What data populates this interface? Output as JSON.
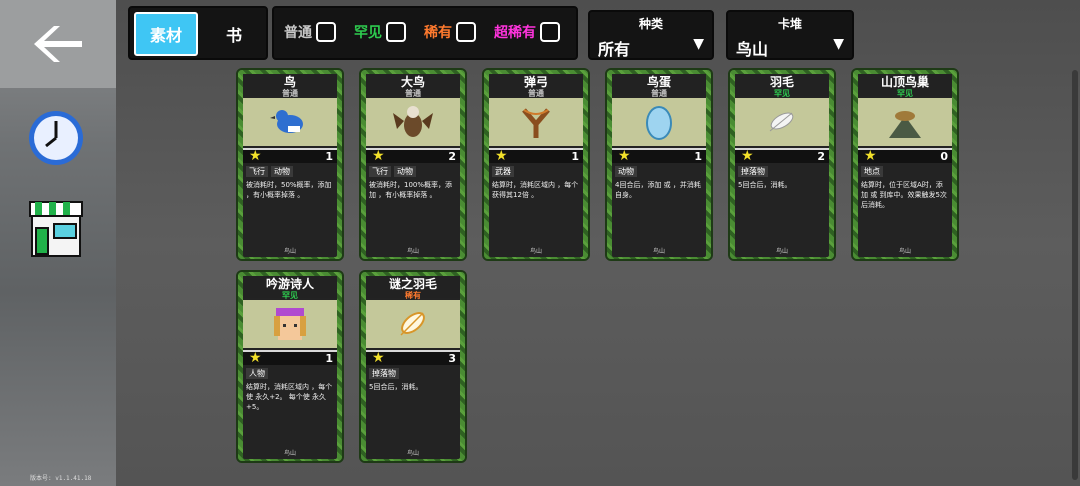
{
  "sidebar": {
    "back_icon": "back-arrow-icon",
    "clock_icon": "clock-icon",
    "shop_icon": "shop-icon",
    "version": "版本号:  v1.1.41.18"
  },
  "tabs": {
    "material": "素材",
    "book": "书"
  },
  "rarity_filters": [
    {
      "label": "普通",
      "color": "#c8c8c8"
    },
    {
      "label": "罕见",
      "color": "#2ecc4f"
    },
    {
      "label": "稀有",
      "color": "#ff7a2e"
    },
    {
      "label": "超稀有",
      "color": "#ff33dd"
    }
  ],
  "category": {
    "label": "种类",
    "value": "所有"
  },
  "deck": {
    "label": "卡堆",
    "value": "鸟山"
  },
  "cards": [
    {
      "name": "鸟",
      "rarity": "普通",
      "rarity_color": "#c8c8c8",
      "value": "1",
      "tags": [
        "飞行",
        "动物"
      ],
      "desc": "被消耗时，50%概率，添加 ，有小概率掉落 。",
      "foot": "鸟山",
      "art": "bird"
    },
    {
      "name": "大鸟",
      "rarity": "普通",
      "rarity_color": "#c8c8c8",
      "value": "2",
      "tags": [
        "飞行",
        "动物"
      ],
      "desc": "被消耗时，100%概率，添加 ，有小概率掉落 。",
      "foot": "鸟山",
      "art": "bigbird"
    },
    {
      "name": "弹弓",
      "rarity": "普通",
      "rarity_color": "#c8c8c8",
      "value": "1",
      "tags": [
        "武器"
      ],
      "desc": "结算时，消耗区域内 ，每个获得其12倍 。",
      "foot": "鸟山",
      "art": "slingshot"
    },
    {
      "name": "鸟蛋",
      "rarity": "普通",
      "rarity_color": "#c8c8c8",
      "value": "1",
      "tags": [
        "动物"
      ],
      "desc": "4回合后，添加 或 ，并消耗自身。",
      "foot": "鸟山",
      "art": "egg"
    },
    {
      "name": "羽毛",
      "rarity": "罕见",
      "rarity_color": "#2ecc4f",
      "value": "2",
      "tags": [
        "掉落物"
      ],
      "desc": "5回合后，消耗。",
      "foot": "鸟山",
      "art": "feather"
    },
    {
      "name": "山顶鸟巢",
      "rarity": "罕见",
      "rarity_color": "#2ecc4f",
      "value": "0",
      "tags": [
        "地点"
      ],
      "desc": "结算时，位于区域A时，添加 或 到库中。效果触发5次后消耗。",
      "foot": "鸟山",
      "art": "nest"
    },
    {
      "name": "吟游诗人",
      "rarity": "罕见",
      "rarity_color": "#2ecc4f",
      "value": "1",
      "tags": [
        "人物"
      ],
      "desc": "结算时，消耗区域内 ，每个使 永久+2。 每个使 永久+5。",
      "foot": "鸟山",
      "art": "bard"
    },
    {
      "name": "谜之羽毛",
      "rarity": "稀有",
      "rarity_color": "#ff7a2e",
      "value": "3",
      "tags": [
        "掉落物"
      ],
      "desc": "5回合后，消耗。",
      "foot": "鸟山",
      "art": "goldfeather"
    }
  ]
}
